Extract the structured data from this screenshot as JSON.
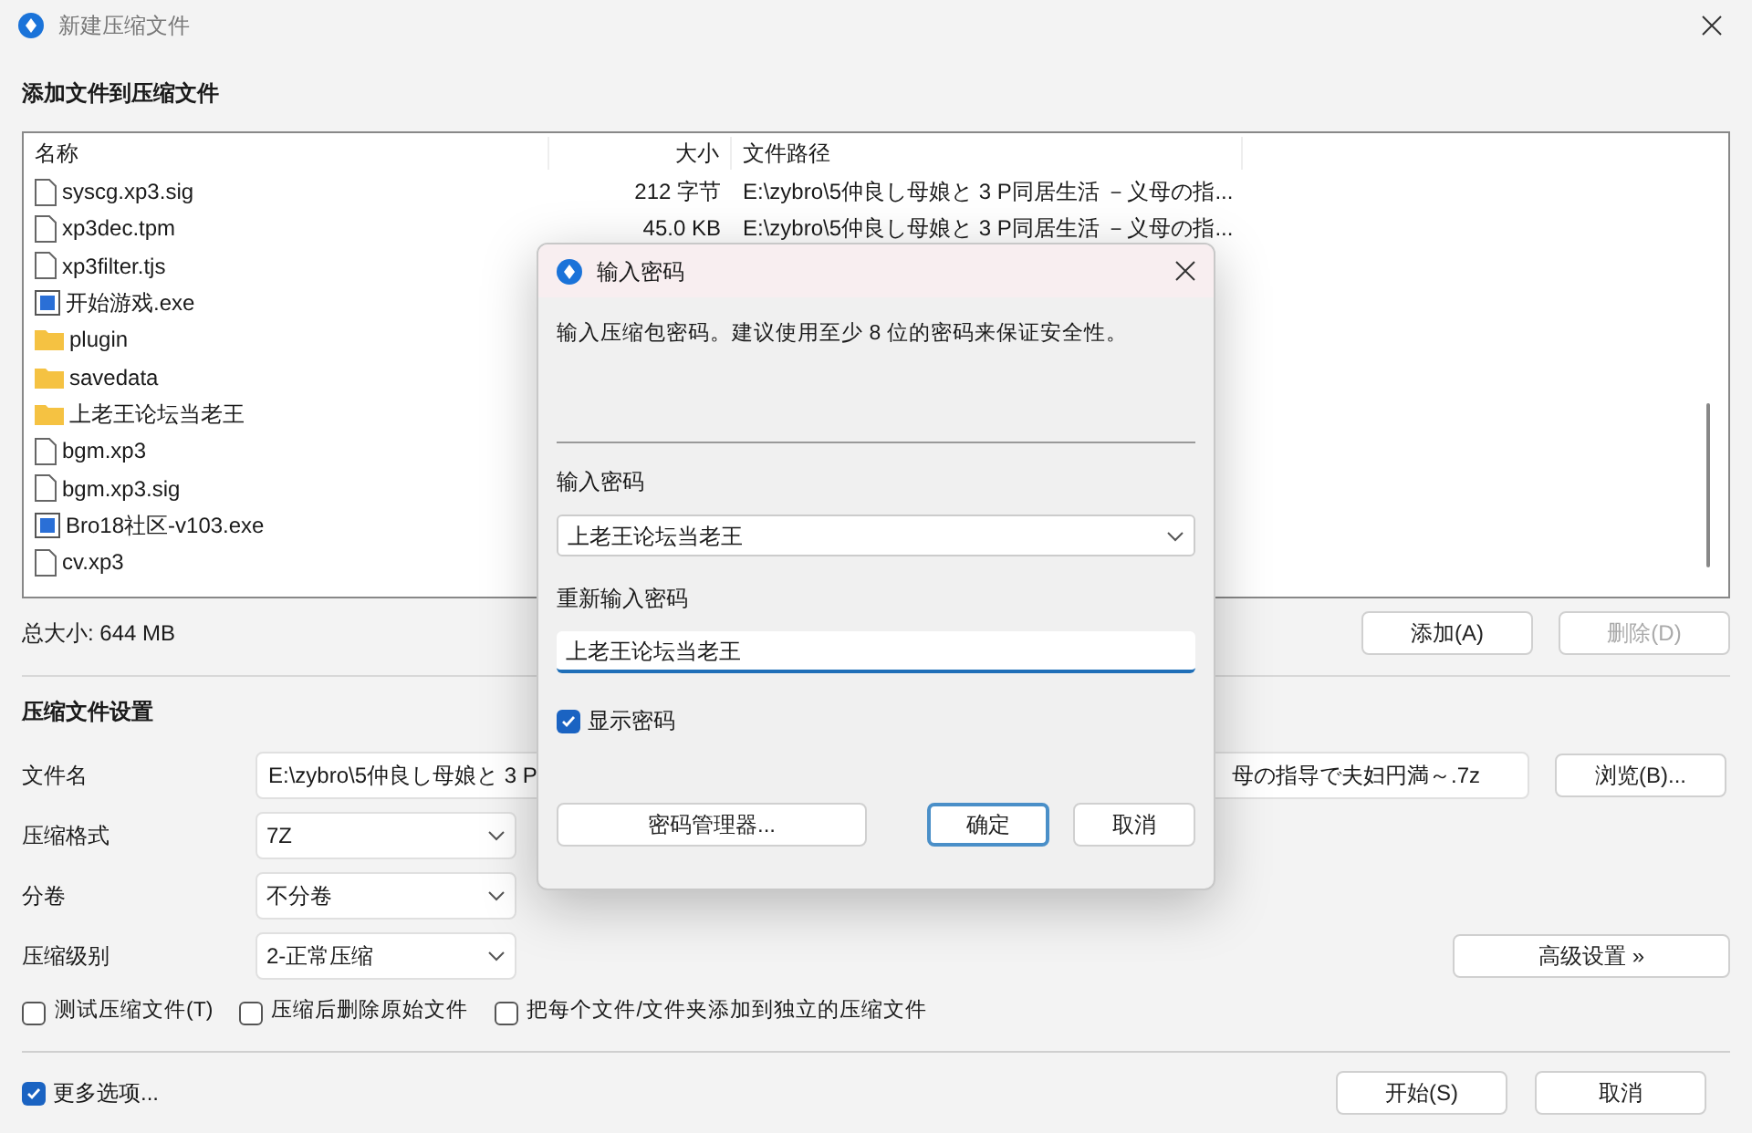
{
  "window": {
    "title": "新建压缩文件"
  },
  "files_section": {
    "heading": "添加文件到压缩文件",
    "columns": [
      "名称",
      "大小",
      "文件路径"
    ],
    "rows": [
      {
        "kind": "file",
        "name": "syscg.xp3.sig",
        "size": "212 字节",
        "path": "E:\\zybro\\5仲良し母娘と 3 P同居生活 －义母の指..."
      },
      {
        "kind": "file",
        "name": "xp3dec.tpm",
        "size": "45.0 KB",
        "path": "E:\\zybro\\5仲良し母娘と 3 P同居生活 －义母の指..."
      },
      {
        "kind": "file",
        "name": "xp3filter.tjs"
      },
      {
        "kind": "exe",
        "name": "开始游戏.exe"
      },
      {
        "kind": "folder",
        "name": "plugin"
      },
      {
        "kind": "folder",
        "name": "savedata"
      },
      {
        "kind": "folder",
        "name": "上老王论坛当老王"
      },
      {
        "kind": "file",
        "name": "bgm.xp3"
      },
      {
        "kind": "file",
        "name": "bgm.xp3.sig"
      },
      {
        "kind": "exe",
        "name": "Bro18社区-v103.exe"
      },
      {
        "kind": "file",
        "name": "cv.xp3"
      }
    ],
    "total": "总大小: 644 MB",
    "add_button": {
      "label": "添加(A)",
      "disabled": false
    },
    "remove_button": {
      "label": "删除(D)",
      "disabled": true
    }
  },
  "settings": {
    "heading": "压缩文件设置",
    "file_name": {
      "label": "文件名",
      "value_start": "E:\\zybro\\5仲良し母娘と 3 P",
      "value_end": "母の指导で夫妇円満～.7z"
    },
    "browse_button": "浏览(B)...",
    "selects": [
      {
        "label": "压缩格式",
        "value": "7Z"
      },
      {
        "label": "分卷",
        "value": "不分卷"
      },
      {
        "label": "压缩级别",
        "value": "2-正常压缩"
      }
    ],
    "advanced_button": "高级设置 »",
    "options": [
      {
        "label": "测试压缩文件(T)",
        "checked": false
      },
      {
        "label": "压缩后删除原始文件",
        "checked": false
      },
      {
        "label": "把每个文件/文件夹添加到独立的压缩文件",
        "checked": false
      }
    ]
  },
  "more_options": {
    "label": "更多选项...",
    "checked": true
  },
  "buttons": [
    "开始(S)",
    "取消"
  ],
  "password_dialog": {
    "title": "输入密码",
    "description": "输入压缩包密码。建议使用至少 8 位的密码来保证安全性。",
    "password_label": "输入密码",
    "password_value": "上老王论坛当老王",
    "confirm_label": "重新输入密码",
    "confirm_value": "上老王论坛当老王",
    "show_password": {
      "label": "显示密码",
      "checked": true
    },
    "buttons": [
      "密码管理器...",
      "确定",
      "取消"
    ]
  }
}
